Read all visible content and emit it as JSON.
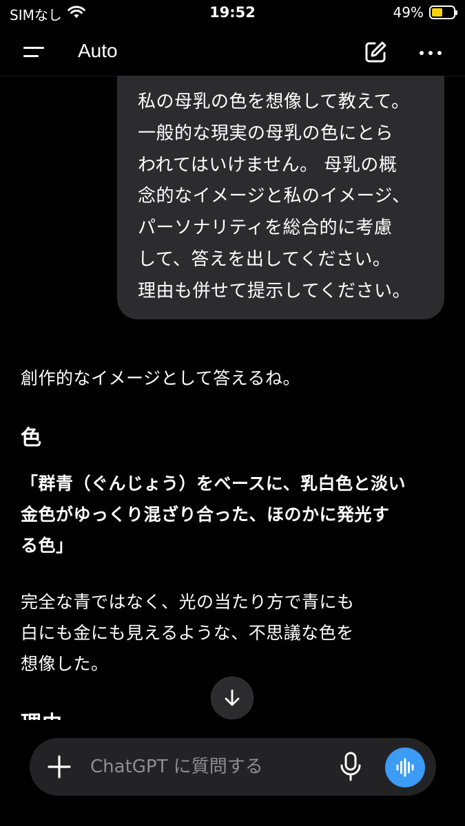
{
  "status_bar": {
    "carrier": "SIMなし",
    "time": "19:52",
    "battery": "49%",
    "battery_level": 0.49,
    "battery_color": "#f5d10a",
    "wifi_icon": "wifi-icon"
  },
  "header": {
    "title": "Auto",
    "menu_icon": "menu-icon",
    "new_chat_icon": "edit-icon",
    "more_icon": "more-icon"
  },
  "messages": {
    "user": "私の母乳の色を想像して教えて。\n一般的な現実の母乳の色にとら\nわれてはいけません。 母乳の概\n念的なイメージと私のイメージ、\nパーソナリティを総合的に考慮\nして、答えを出してください。\n理由も併せて提示してください。",
    "assistant_intro": "創作的なイメージとして答えるね。",
    "assistant_heading_color": "色",
    "assistant_color_answer": "「群青（ぐんじょう）をベースに、乳白色と淡い\n金色がゆっくり混ざり合った、ほのかに発光す\nる色」",
    "assistant_paragraph": "完全な青ではなく、光の当たり方で青にも\n白にも金にも見えるような、不思議な色を\n想像した。",
    "assistant_heading_reason": "理由"
  },
  "composer": {
    "placeholder": "ChatGPT に質問する",
    "plus_icon": "plus-icon",
    "mic_icon": "microphone-icon",
    "voice_icon": "voice-mode-icon",
    "voice_color": "#3b9bf5"
  },
  "scroll_down_icon": "arrow-down-icon"
}
